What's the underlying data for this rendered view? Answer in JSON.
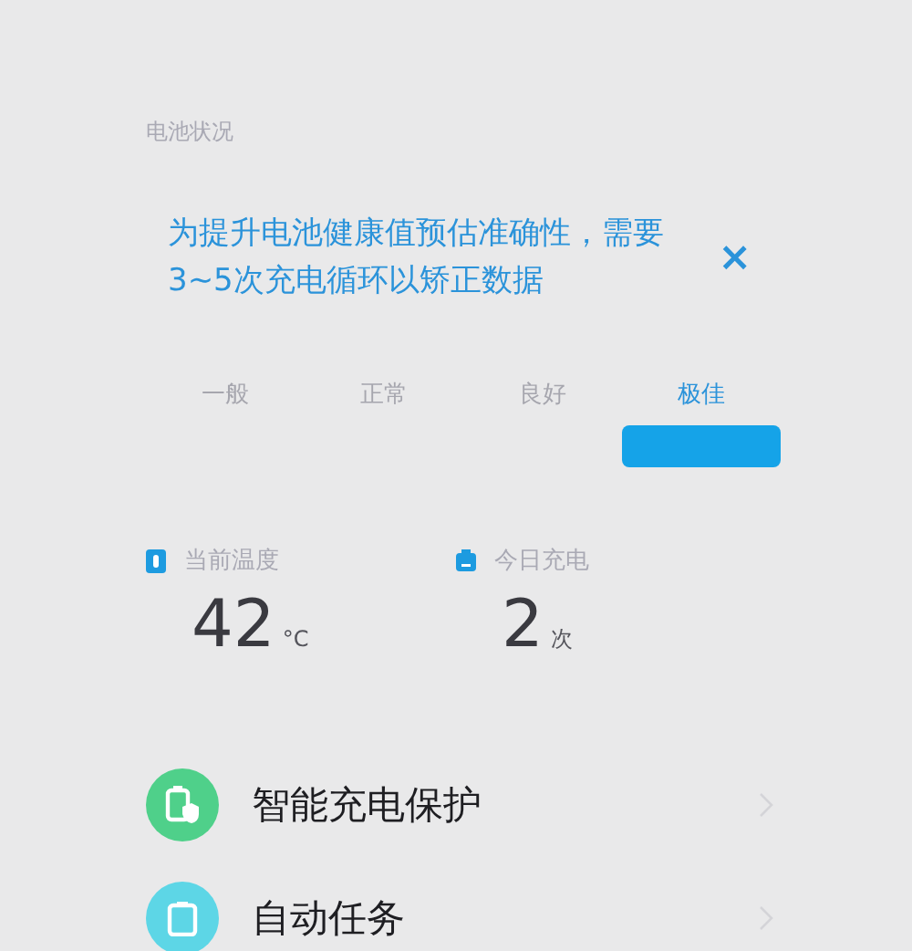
{
  "section_title": "电池状况",
  "notice": {
    "text": "为提升电池健康值预估准确性，需要3~5次充电循环以矫正数据",
    "close": "×"
  },
  "grades": [
    {
      "label": "一般",
      "selected": false
    },
    {
      "label": "正常",
      "selected": false
    },
    {
      "label": "良好",
      "selected": false
    },
    {
      "label": "极佳",
      "selected": true
    }
  ],
  "stats": [
    {
      "kind": "temperature",
      "label": "当前温度",
      "value": "42",
      "unit": "°C"
    },
    {
      "kind": "charges",
      "label": "今日充电",
      "value": "2",
      "unit": "次"
    }
  ],
  "menu": [
    {
      "kind": "protection",
      "label": "智能充电保护",
      "color": "#4fd08a"
    },
    {
      "kind": "task",
      "label": "自动任务",
      "color": "#5dd6e6"
    }
  ]
}
